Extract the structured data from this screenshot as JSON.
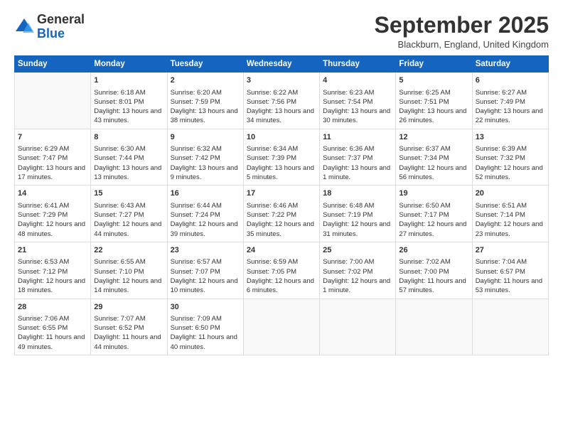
{
  "header": {
    "logo_line1": "General",
    "logo_line2": "Blue",
    "month_title": "September 2025",
    "location": "Blackburn, England, United Kingdom"
  },
  "days_of_week": [
    "Sunday",
    "Monday",
    "Tuesday",
    "Wednesday",
    "Thursday",
    "Friday",
    "Saturday"
  ],
  "weeks": [
    [
      {
        "day": "",
        "sunrise": "",
        "sunset": "",
        "daylight": ""
      },
      {
        "day": "1",
        "sunrise": "Sunrise: 6:18 AM",
        "sunset": "Sunset: 8:01 PM",
        "daylight": "Daylight: 13 hours and 43 minutes."
      },
      {
        "day": "2",
        "sunrise": "Sunrise: 6:20 AM",
        "sunset": "Sunset: 7:59 PM",
        "daylight": "Daylight: 13 hours and 38 minutes."
      },
      {
        "day": "3",
        "sunrise": "Sunrise: 6:22 AM",
        "sunset": "Sunset: 7:56 PM",
        "daylight": "Daylight: 13 hours and 34 minutes."
      },
      {
        "day": "4",
        "sunrise": "Sunrise: 6:23 AM",
        "sunset": "Sunset: 7:54 PM",
        "daylight": "Daylight: 13 hours and 30 minutes."
      },
      {
        "day": "5",
        "sunrise": "Sunrise: 6:25 AM",
        "sunset": "Sunset: 7:51 PM",
        "daylight": "Daylight: 13 hours and 26 minutes."
      },
      {
        "day": "6",
        "sunrise": "Sunrise: 6:27 AM",
        "sunset": "Sunset: 7:49 PM",
        "daylight": "Daylight: 13 hours and 22 minutes."
      }
    ],
    [
      {
        "day": "7",
        "sunrise": "Sunrise: 6:29 AM",
        "sunset": "Sunset: 7:47 PM",
        "daylight": "Daylight: 13 hours and 17 minutes."
      },
      {
        "day": "8",
        "sunrise": "Sunrise: 6:30 AM",
        "sunset": "Sunset: 7:44 PM",
        "daylight": "Daylight: 13 hours and 13 minutes."
      },
      {
        "day": "9",
        "sunrise": "Sunrise: 6:32 AM",
        "sunset": "Sunset: 7:42 PM",
        "daylight": "Daylight: 13 hours and 9 minutes."
      },
      {
        "day": "10",
        "sunrise": "Sunrise: 6:34 AM",
        "sunset": "Sunset: 7:39 PM",
        "daylight": "Daylight: 13 hours and 5 minutes."
      },
      {
        "day": "11",
        "sunrise": "Sunrise: 6:36 AM",
        "sunset": "Sunset: 7:37 PM",
        "daylight": "Daylight: 13 hours and 1 minute."
      },
      {
        "day": "12",
        "sunrise": "Sunrise: 6:37 AM",
        "sunset": "Sunset: 7:34 PM",
        "daylight": "Daylight: 12 hours and 56 minutes."
      },
      {
        "day": "13",
        "sunrise": "Sunrise: 6:39 AM",
        "sunset": "Sunset: 7:32 PM",
        "daylight": "Daylight: 12 hours and 52 minutes."
      }
    ],
    [
      {
        "day": "14",
        "sunrise": "Sunrise: 6:41 AM",
        "sunset": "Sunset: 7:29 PM",
        "daylight": "Daylight: 12 hours and 48 minutes."
      },
      {
        "day": "15",
        "sunrise": "Sunrise: 6:43 AM",
        "sunset": "Sunset: 7:27 PM",
        "daylight": "Daylight: 12 hours and 44 minutes."
      },
      {
        "day": "16",
        "sunrise": "Sunrise: 6:44 AM",
        "sunset": "Sunset: 7:24 PM",
        "daylight": "Daylight: 12 hours and 39 minutes."
      },
      {
        "day": "17",
        "sunrise": "Sunrise: 6:46 AM",
        "sunset": "Sunset: 7:22 PM",
        "daylight": "Daylight: 12 hours and 35 minutes."
      },
      {
        "day": "18",
        "sunrise": "Sunrise: 6:48 AM",
        "sunset": "Sunset: 7:19 PM",
        "daylight": "Daylight: 12 hours and 31 minutes."
      },
      {
        "day": "19",
        "sunrise": "Sunrise: 6:50 AM",
        "sunset": "Sunset: 7:17 PM",
        "daylight": "Daylight: 12 hours and 27 minutes."
      },
      {
        "day": "20",
        "sunrise": "Sunrise: 6:51 AM",
        "sunset": "Sunset: 7:14 PM",
        "daylight": "Daylight: 12 hours and 23 minutes."
      }
    ],
    [
      {
        "day": "21",
        "sunrise": "Sunrise: 6:53 AM",
        "sunset": "Sunset: 7:12 PM",
        "daylight": "Daylight: 12 hours and 18 minutes."
      },
      {
        "day": "22",
        "sunrise": "Sunrise: 6:55 AM",
        "sunset": "Sunset: 7:10 PM",
        "daylight": "Daylight: 12 hours and 14 minutes."
      },
      {
        "day": "23",
        "sunrise": "Sunrise: 6:57 AM",
        "sunset": "Sunset: 7:07 PM",
        "daylight": "Daylight: 12 hours and 10 minutes."
      },
      {
        "day": "24",
        "sunrise": "Sunrise: 6:59 AM",
        "sunset": "Sunset: 7:05 PM",
        "daylight": "Daylight: 12 hours and 6 minutes."
      },
      {
        "day": "25",
        "sunrise": "Sunrise: 7:00 AM",
        "sunset": "Sunset: 7:02 PM",
        "daylight": "Daylight: 12 hours and 1 minute."
      },
      {
        "day": "26",
        "sunrise": "Sunrise: 7:02 AM",
        "sunset": "Sunset: 7:00 PM",
        "daylight": "Daylight: 11 hours and 57 minutes."
      },
      {
        "day": "27",
        "sunrise": "Sunrise: 7:04 AM",
        "sunset": "Sunset: 6:57 PM",
        "daylight": "Daylight: 11 hours and 53 minutes."
      }
    ],
    [
      {
        "day": "28",
        "sunrise": "Sunrise: 7:06 AM",
        "sunset": "Sunset: 6:55 PM",
        "daylight": "Daylight: 11 hours and 49 minutes."
      },
      {
        "day": "29",
        "sunrise": "Sunrise: 7:07 AM",
        "sunset": "Sunset: 6:52 PM",
        "daylight": "Daylight: 11 hours and 44 minutes."
      },
      {
        "day": "30",
        "sunrise": "Sunrise: 7:09 AM",
        "sunset": "Sunset: 6:50 PM",
        "daylight": "Daylight: 11 hours and 40 minutes."
      },
      {
        "day": "",
        "sunrise": "",
        "sunset": "",
        "daylight": ""
      },
      {
        "day": "",
        "sunrise": "",
        "sunset": "",
        "daylight": ""
      },
      {
        "day": "",
        "sunrise": "",
        "sunset": "",
        "daylight": ""
      },
      {
        "day": "",
        "sunrise": "",
        "sunset": "",
        "daylight": ""
      }
    ]
  ]
}
